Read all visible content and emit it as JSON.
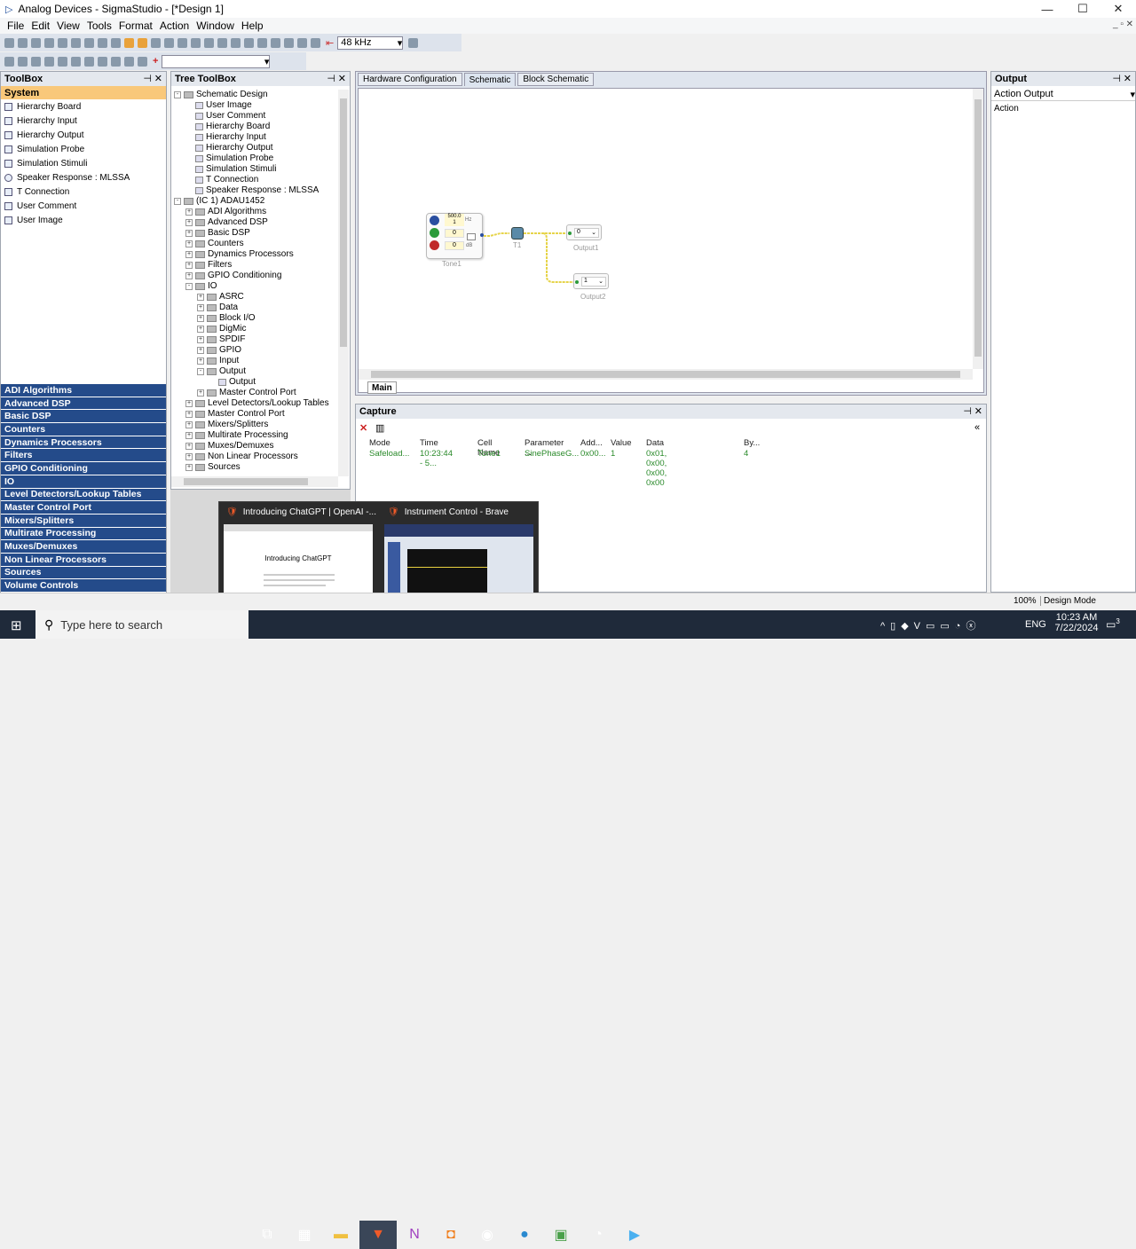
{
  "window": {
    "title": "Analog Devices - SigmaStudio - [*Design 1]",
    "minimize": "—",
    "maximize": "☐",
    "close": "✕"
  },
  "menu": [
    "File",
    "Edit",
    "View",
    "Tools",
    "Format",
    "Action",
    "Window",
    "Help"
  ],
  "toolbar": {
    "sample_rate": "48 kHz"
  },
  "toolbox": {
    "title": "ToolBox",
    "section": "System",
    "items": [
      "Hierarchy Board",
      "Hierarchy Input",
      "Hierarchy Output",
      "Simulation Probe",
      "Simulation Stimuli",
      "Speaker Response : MLSSA",
      "T Connection",
      "User Comment",
      "User Image"
    ],
    "categories": [
      "ADI Algorithms",
      "Advanced DSP",
      "Basic DSP",
      "Counters",
      "Dynamics Processors",
      "Filters",
      "GPIO Conditioning",
      "IO",
      "Level Detectors/Lookup Tables",
      "Master Control Port",
      "Mixers/Splitters",
      "Multirate Processing",
      "Muxes/Demuxes",
      "Non Linear Processors",
      "Sources",
      "Volume Controls"
    ]
  },
  "tree": {
    "title": "Tree ToolBox",
    "rows": [
      {
        "t": "Schematic Design",
        "d": 0,
        "pm": "-"
      },
      {
        "t": "User Image",
        "d": 1,
        "pm": ""
      },
      {
        "t": "User Comment",
        "d": 1,
        "pm": ""
      },
      {
        "t": "Hierarchy Board",
        "d": 1,
        "pm": ""
      },
      {
        "t": "Hierarchy Input",
        "d": 1,
        "pm": ""
      },
      {
        "t": "Hierarchy Output",
        "d": 1,
        "pm": ""
      },
      {
        "t": "Simulation Probe",
        "d": 1,
        "pm": ""
      },
      {
        "t": "Simulation Stimuli",
        "d": 1,
        "pm": ""
      },
      {
        "t": "T Connection",
        "d": 1,
        "pm": ""
      },
      {
        "t": "Speaker Response : MLSSA",
        "d": 1,
        "pm": ""
      },
      {
        "t": "(IC 1) ADAU1452",
        "d": 0,
        "pm": "-"
      },
      {
        "t": "ADI Algorithms",
        "d": 1,
        "pm": "+"
      },
      {
        "t": "Advanced DSP",
        "d": 1,
        "pm": "+"
      },
      {
        "t": "Basic DSP",
        "d": 1,
        "pm": "+"
      },
      {
        "t": "Counters",
        "d": 1,
        "pm": "+"
      },
      {
        "t": "Dynamics Processors",
        "d": 1,
        "pm": "+"
      },
      {
        "t": "Filters",
        "d": 1,
        "pm": "+"
      },
      {
        "t": "GPIO Conditioning",
        "d": 1,
        "pm": "+"
      },
      {
        "t": "IO",
        "d": 1,
        "pm": "-"
      },
      {
        "t": "ASRC",
        "d": 2,
        "pm": "+"
      },
      {
        "t": "Data",
        "d": 2,
        "pm": "+"
      },
      {
        "t": "Block I/O",
        "d": 2,
        "pm": "+"
      },
      {
        "t": "DigMic",
        "d": 2,
        "pm": "+"
      },
      {
        "t": "SPDIF",
        "d": 2,
        "pm": "+"
      },
      {
        "t": "GPIO",
        "d": 2,
        "pm": "+"
      },
      {
        "t": "Input",
        "d": 2,
        "pm": "+"
      },
      {
        "t": "Output",
        "d": 2,
        "pm": "-"
      },
      {
        "t": "Output",
        "d": 3,
        "pm": ""
      },
      {
        "t": "Master Control Port",
        "d": 2,
        "pm": "+"
      },
      {
        "t": "Level Detectors/Lookup Tables",
        "d": 1,
        "pm": "+"
      },
      {
        "t": "Master Control Port",
        "d": 1,
        "pm": "+"
      },
      {
        "t": "Mixers/Splitters",
        "d": 1,
        "pm": "+"
      },
      {
        "t": "Multirate Processing",
        "d": 1,
        "pm": "+"
      },
      {
        "t": "Muxes/Demuxes",
        "d": 1,
        "pm": "+"
      },
      {
        "t": "Non Linear Processors",
        "d": 1,
        "pm": "+"
      },
      {
        "t": "Sources",
        "d": 1,
        "pm": "+"
      }
    ]
  },
  "tabs": [
    "Hardware Configuration",
    "Schematic",
    "Block Schematic"
  ],
  "schematic": {
    "tone_label": "Tone1",
    "tone_freq": "500.0",
    "tone_f2": "1",
    "tone_hz": "Hz",
    "tone_v1": "0",
    "tone_v2": "0",
    "tone_db": "dB",
    "t_label": "T1",
    "out1_val": "0",
    "out1_label": "Output1",
    "out2_val": "1",
    "out2_label": "Output2",
    "sheet_tab": "Main"
  },
  "output": {
    "title": "Output",
    "select": "Action Output",
    "text": "Action"
  },
  "capture": {
    "title": "Capture",
    "columns": [
      "Mode",
      "Time",
      "Cell Name",
      "Parameter ...",
      "Add...",
      "Value",
      "Data",
      "By..."
    ],
    "row": [
      "Safeload...",
      "10:23:44 - 5...",
      "Tone1",
      "SinePhaseG...",
      "0x00...",
      "1",
      "0x01, 0x00, 0x00, 0x00",
      "4"
    ]
  },
  "thumbs": [
    {
      "title": "Introducing ChatGPT | OpenAI -...",
      "heading": "Introducing ChatGPT"
    },
    {
      "title": "Instrument Control - Brave"
    }
  ],
  "status": {
    "zoom": "100%",
    "mode": "Design Mode"
  },
  "taskbar": {
    "search": "Type here to search",
    "lang": "ENG",
    "time": "10:23 AM",
    "date": "7/22/2024",
    "notif": "3"
  }
}
